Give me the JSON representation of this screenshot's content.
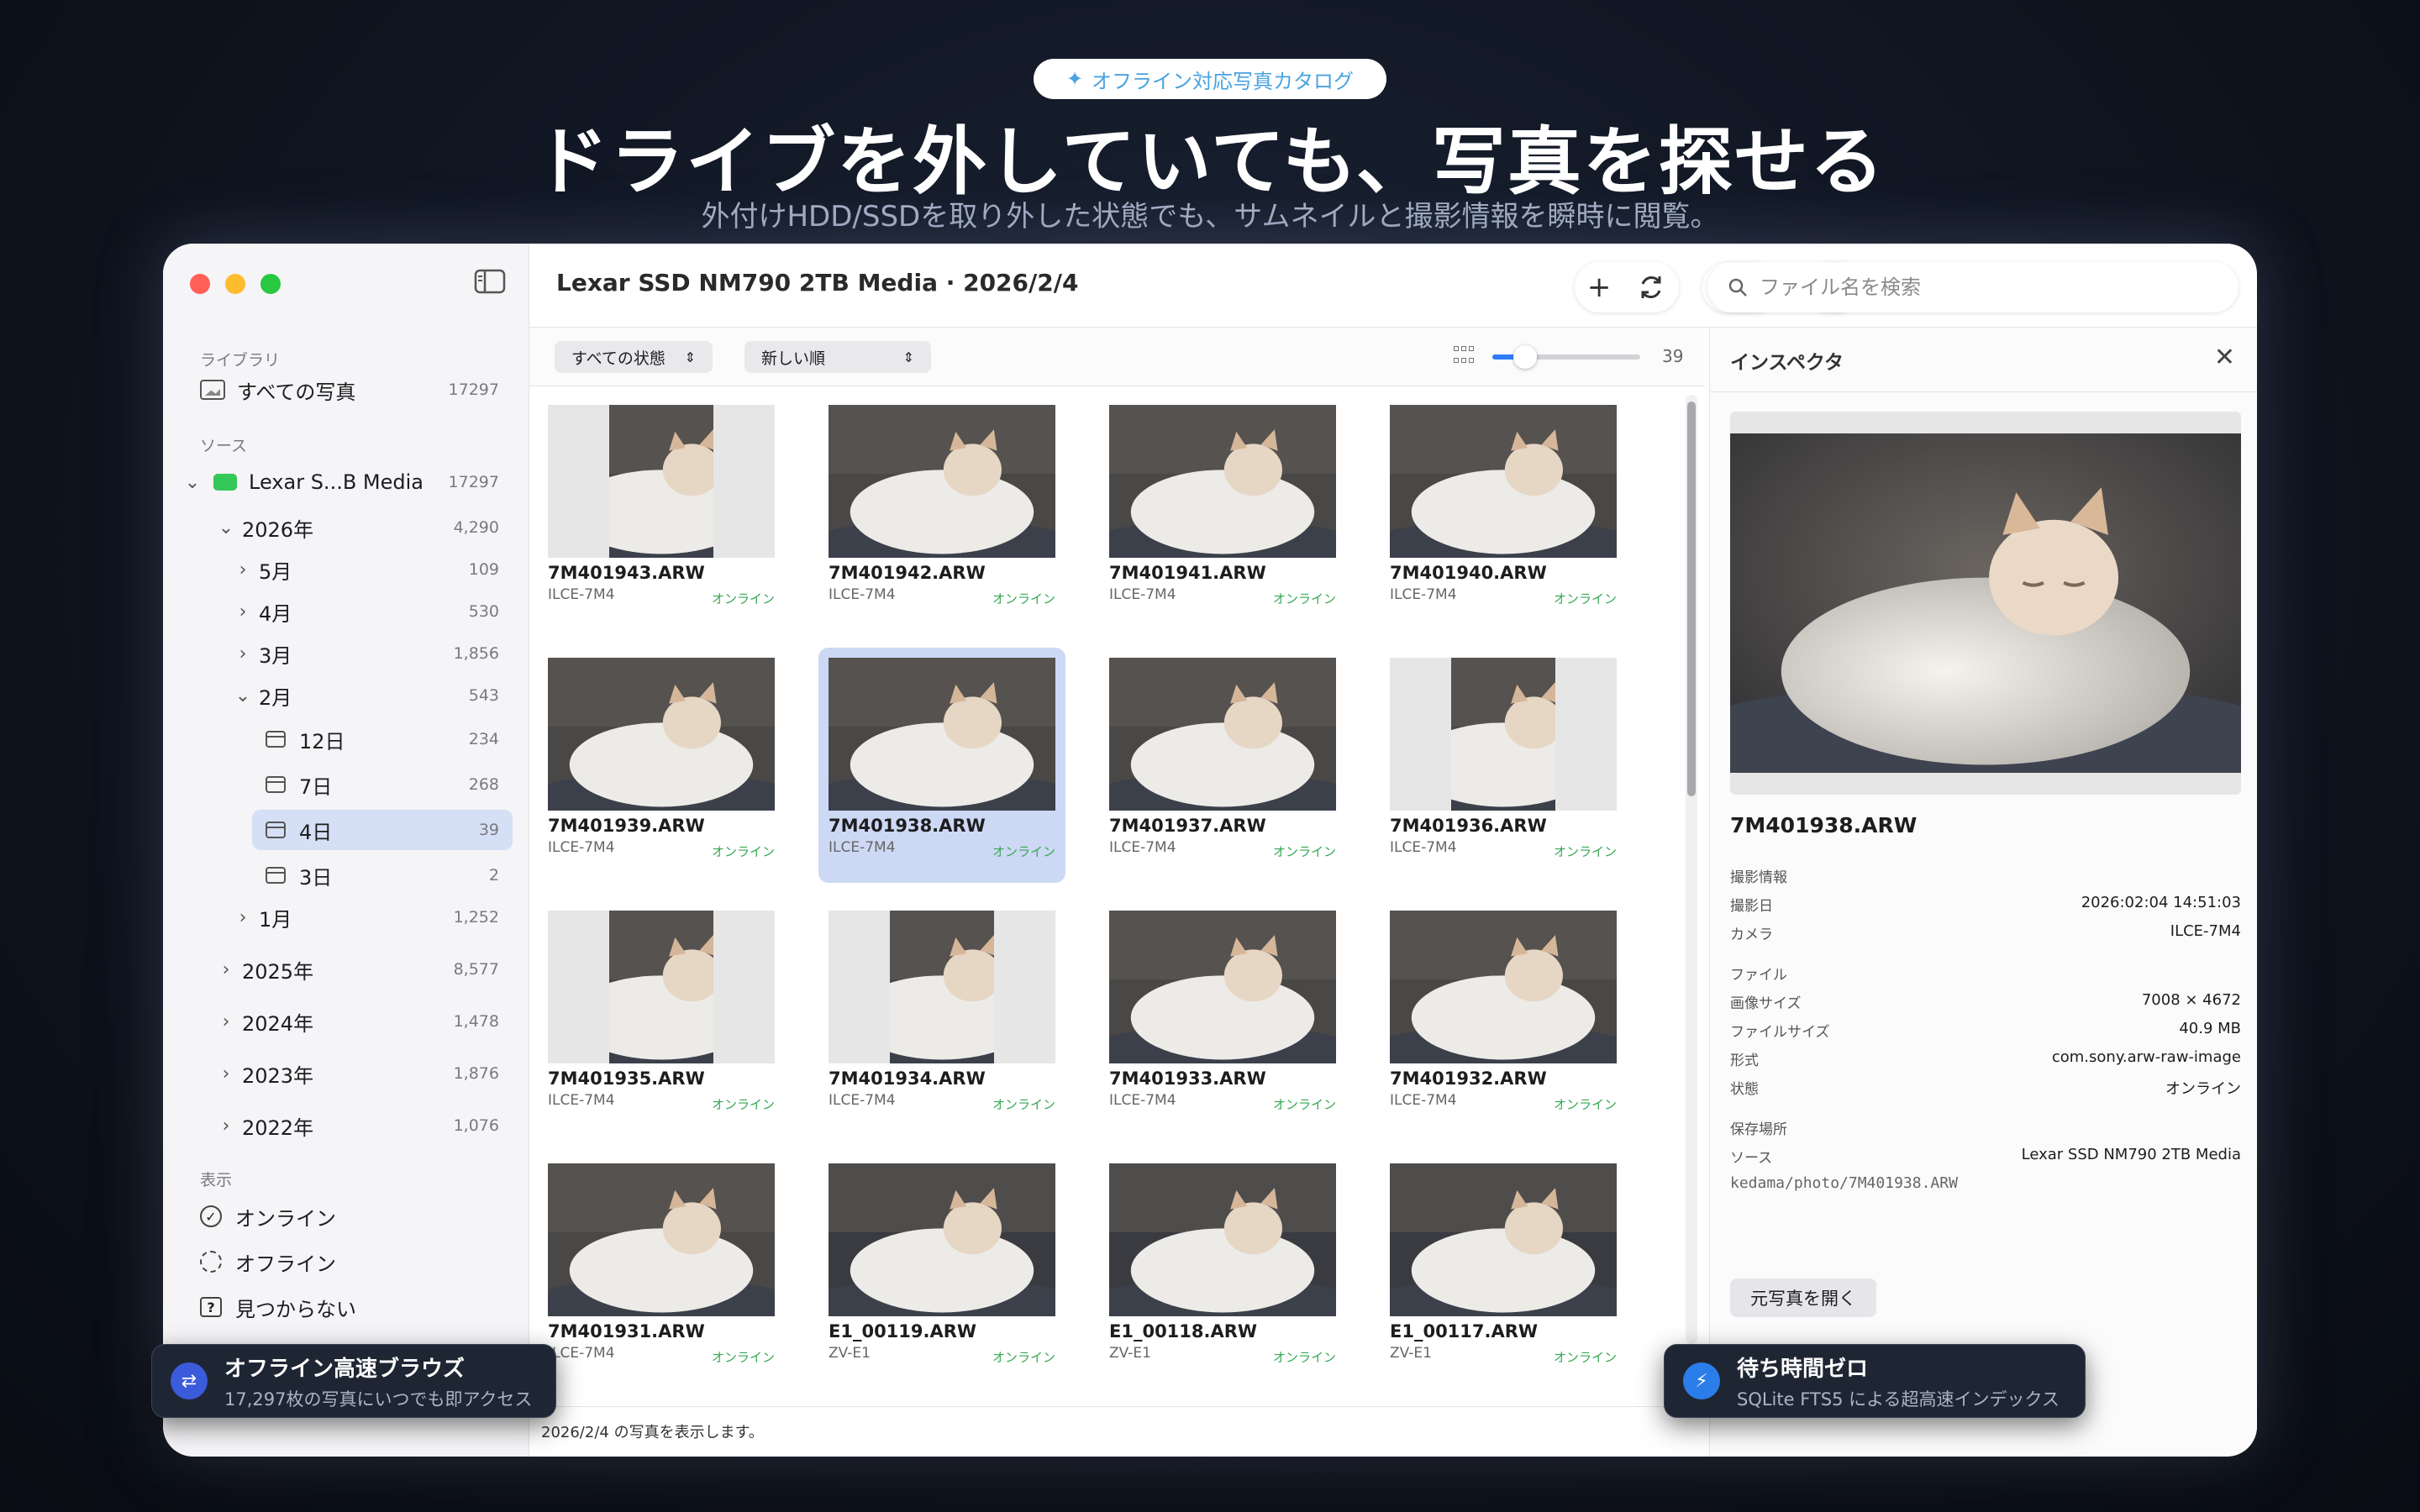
{
  "hero": {
    "badge": "オフライン対応写真カタログ",
    "title": "ドライブを外していても、写真を探せる",
    "subtitle": "外付けHDD/SSDを取り外した状態でも、サムネイルと撮影情報を瞬時に閲覧。"
  },
  "sidebar": {
    "library_header": "ライブラリ",
    "all_photos": {
      "label": "すべての写真",
      "count": "17297"
    },
    "source_header": "ソース",
    "source": {
      "label": "Lexar S...B Media",
      "count": "17297"
    },
    "tree": [
      {
        "label": "2026年",
        "count": "4,290"
      },
      {
        "label": "5月",
        "count": "109"
      },
      {
        "label": "4月",
        "count": "530"
      },
      {
        "label": "3月",
        "count": "1,856"
      },
      {
        "label": "2月",
        "count": "543"
      },
      {
        "label": "12日",
        "count": "234"
      },
      {
        "label": "7日",
        "count": "268"
      },
      {
        "label": "4日",
        "count": "39"
      },
      {
        "label": "3日",
        "count": "2"
      },
      {
        "label": "1月",
        "count": "1,252"
      },
      {
        "label": "2025年",
        "count": "8,577"
      },
      {
        "label": "2024年",
        "count": "1,478"
      },
      {
        "label": "2023年",
        "count": "1,876"
      },
      {
        "label": "2022年",
        "count": "1,076"
      }
    ],
    "display_header": "表示",
    "display": [
      {
        "label": "オンライン"
      },
      {
        "label": "オフライン"
      },
      {
        "label": "見つからない"
      }
    ]
  },
  "toolbar": {
    "title": "Lexar SSD NM790 2TB Media · 2026/2/4",
    "search_placeholder": "ファイル名を検索"
  },
  "filter": {
    "status": "すべての状態",
    "sort": "新しい順",
    "zoom_fraction": 0.22,
    "count": "39"
  },
  "photos": [
    {
      "name": "7M401943.ARW",
      "camera": "ILCE-7M4",
      "status": "オンライン",
      "portrait": true
    },
    {
      "name": "7M401942.ARW",
      "camera": "ILCE-7M4",
      "status": "オンライン",
      "portrait": false
    },
    {
      "name": "7M401941.ARW",
      "camera": "ILCE-7M4",
      "status": "オンライン",
      "portrait": false
    },
    {
      "name": "7M401940.ARW",
      "camera": "ILCE-7M4",
      "status": "オンライン",
      "portrait": false
    },
    {
      "name": "7M401939.ARW",
      "camera": "ILCE-7M4",
      "status": "オンライン",
      "portrait": false
    },
    {
      "name": "7M401938.ARW",
      "camera": "ILCE-7M4",
      "status": "オンライン",
      "portrait": false,
      "selected": true
    },
    {
      "name": "7M401937.ARW",
      "camera": "ILCE-7M4",
      "status": "オンライン",
      "portrait": false
    },
    {
      "name": "7M401936.ARW",
      "camera": "ILCE-7M4",
      "status": "オンライン",
      "portrait": true
    },
    {
      "name": "7M401935.ARW",
      "camera": "ILCE-7M4",
      "status": "オンライン",
      "portrait": true
    },
    {
      "name": "7M401934.ARW",
      "camera": "ILCE-7M4",
      "status": "オンライン",
      "portrait": true
    },
    {
      "name": "7M401933.ARW",
      "camera": "ILCE-7M4",
      "status": "オンライン",
      "portrait": false
    },
    {
      "name": "7M401932.ARW",
      "camera": "ILCE-7M4",
      "status": "オンライン",
      "portrait": false
    },
    {
      "name": "7M401931.ARW",
      "camera": "ILCE-7M4",
      "status": "オンライン",
      "portrait": false
    },
    {
      "name": "E1_00119.ARW",
      "camera": "ZV-E1",
      "status": "オンライン",
      "portrait": false
    },
    {
      "name": "E1_00118.ARW",
      "camera": "ZV-E1",
      "status": "オンライン",
      "portrait": false
    },
    {
      "name": "E1_00117.ARW",
      "camera": "ZV-E1",
      "status": "オンライン",
      "portrait": false
    }
  ],
  "statusbar": {
    "text": "2026/2/4 の写真を表示します。"
  },
  "inspector": {
    "title": "インスペクタ",
    "filename": "7M401938.ARW",
    "shoot_header": "撮影情報",
    "shoot_date_key": "撮影日",
    "shoot_date": "2026:02:04 14:51:03",
    "camera_key": "カメラ",
    "camera": "ILCE-7M4",
    "file_header": "ファイル",
    "size_key": "画像サイズ",
    "size": "7008 × 4672",
    "filesize_key": "ファイルサイズ",
    "filesize": "40.9 MB",
    "format_key": "形式",
    "format": "com.sony.arw-raw-image",
    "state_key": "状態",
    "state": "オンライン",
    "location_header": "保存場所",
    "source_key": "ソース",
    "source": "Lexar SSD NM790 2TB Media",
    "path": "kedama/photo/7M401938.ARW",
    "open_button": "元写真を開く"
  },
  "toasts": {
    "left": {
      "title": "オフライン高速ブラウズ",
      "subtitle": "17,297枚の写真にいつでも即アクセス"
    },
    "right": {
      "title": "待ち時間ゼロ",
      "subtitle": "SQLite FTS5 による超高速インデックス"
    }
  },
  "colors": {
    "accent": "#2f7cf6",
    "online": "#34a853",
    "selection": "#cdd8f4"
  }
}
